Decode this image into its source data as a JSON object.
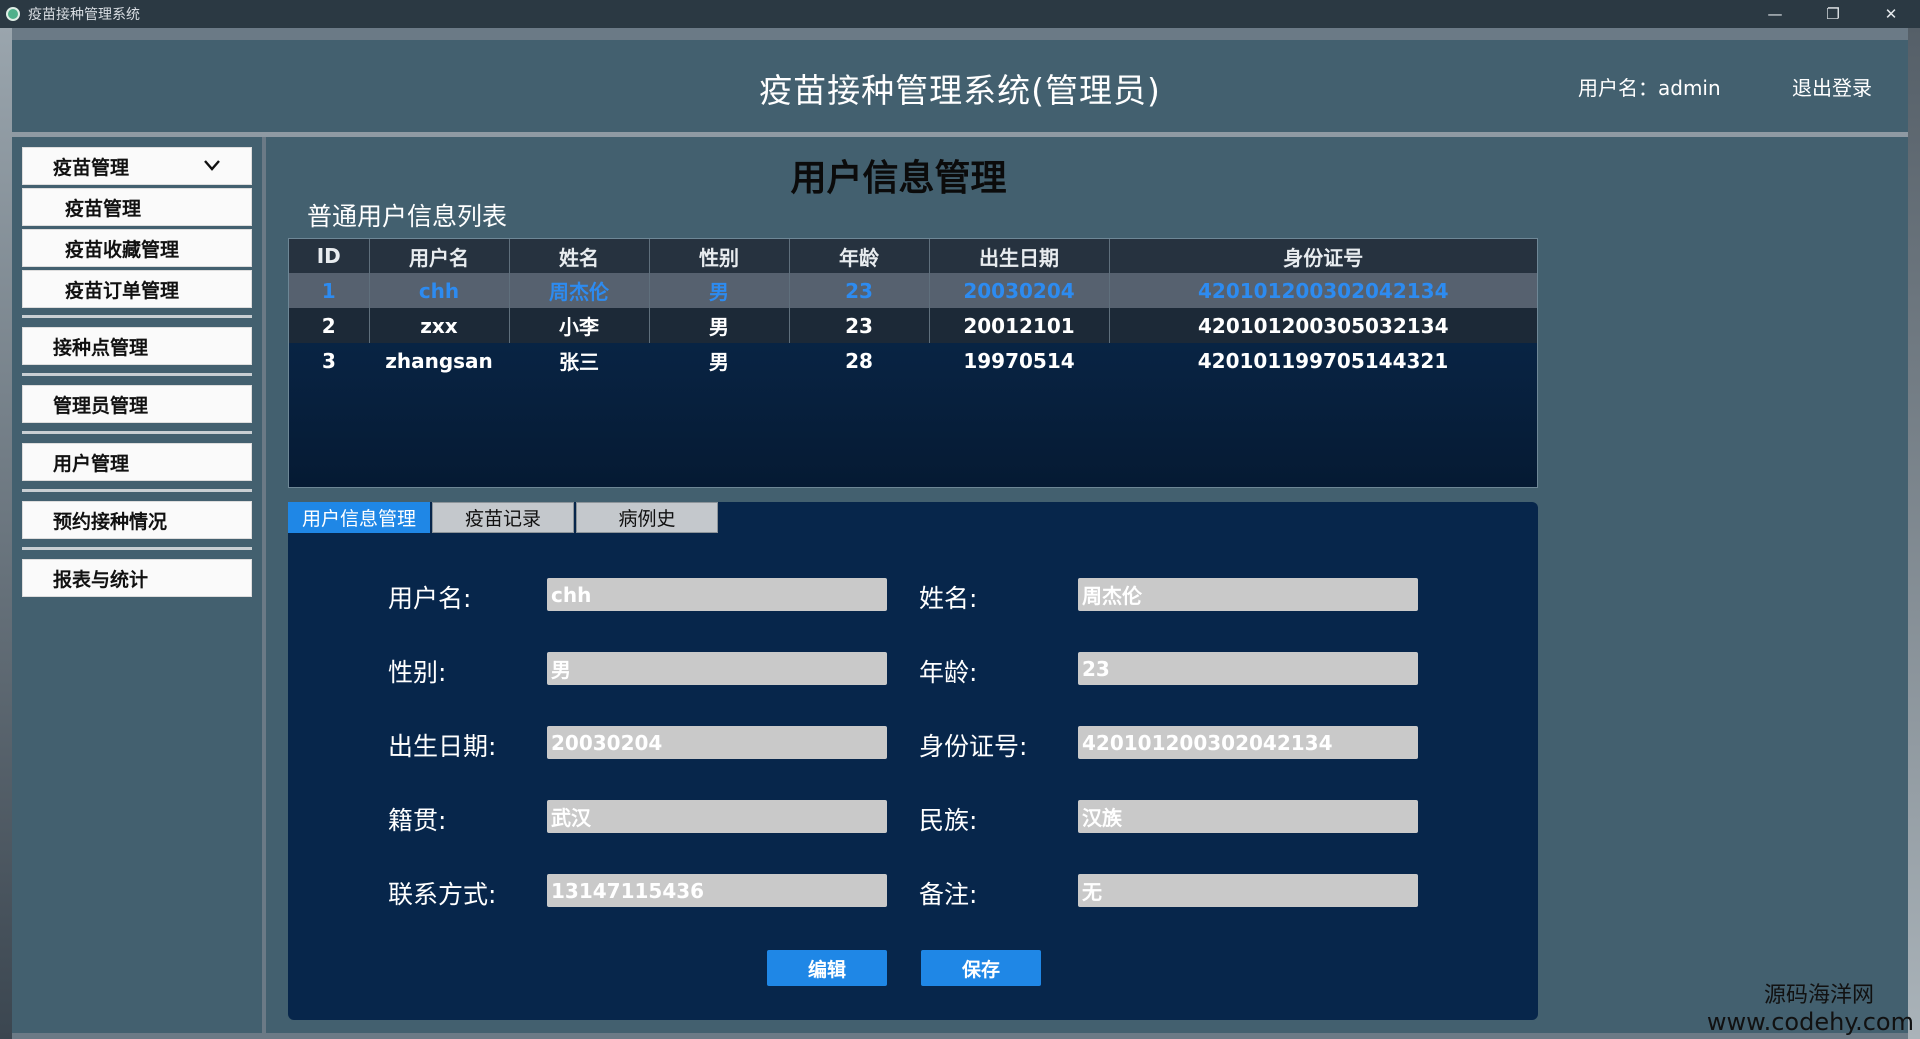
{
  "window": {
    "title": "疫苗接种管理系统",
    "minimize": "—",
    "restore": "❐",
    "close": "✕"
  },
  "header": {
    "title": "疫苗接种管理系统(管理员)",
    "user_label": "用户名：admin",
    "logout": "退出登录"
  },
  "sidebar": {
    "group": "疫苗管理",
    "sub_items": [
      "疫苗管理",
      "疫苗收藏管理",
      "疫苗订单管理"
    ],
    "items": [
      "接种点管理",
      "管理员管理",
      "用户管理",
      "预约接种情况",
      "报表与统计"
    ]
  },
  "main": {
    "page_title": "用户信息管理",
    "list_title": "普通用户信息列表"
  },
  "table": {
    "columns": [
      "ID",
      "用户名",
      "姓名",
      "性别",
      "年龄",
      "出生日期",
      "身份证号"
    ],
    "rows": [
      [
        "1",
        "chh",
        "周杰伦",
        "男",
        "23",
        "20030204",
        "420101200302042134"
      ],
      [
        "2",
        "zxx",
        "小李",
        "男",
        "23",
        "20012101",
        "420101200305032134"
      ],
      [
        "3",
        "zhangsan",
        "张三",
        "男",
        "28",
        "19970514",
        "420101199705144321"
      ]
    ]
  },
  "tabs": [
    "用户信息管理",
    "疫苗记录",
    "病例史"
  ],
  "form": {
    "username_label": "用户名:",
    "username": "chh",
    "name_label": "姓名:",
    "name": "周杰伦",
    "gender_label": "性别:",
    "gender": "男",
    "age_label": "年龄:",
    "age": "23",
    "birth_label": "出生日期:",
    "birth": "20030204",
    "id_label": "身份证号:",
    "id_number": "420101200302042134",
    "native_label": "籍贯:",
    "native": "武汉",
    "ethnic_label": "民族:",
    "ethnic": "汉族",
    "contact_label": "联系方式:",
    "contact": "13147115436",
    "remark_label": "备注:",
    "remark": "无"
  },
  "buttons": {
    "edit": "编辑",
    "save": "保存"
  },
  "watermark": {
    "line1": "源码海洋网",
    "line2": "www.codehy.com"
  },
  "colors": {
    "accent": "#1f87e6",
    "header_bg": "#43606f",
    "panel_bg": "#07264b",
    "selected_text": "#2d8bf0"
  }
}
